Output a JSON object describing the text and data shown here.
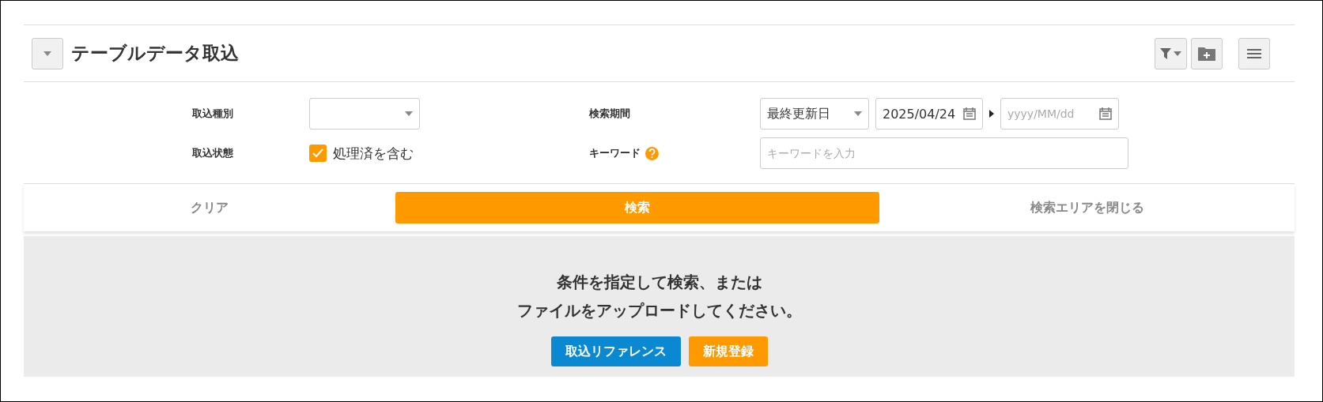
{
  "header": {
    "title": "テーブルデータ取込"
  },
  "search_form": {
    "fields": [
      {
        "kind": "select",
        "label": "取込種別"
      },
      {
        "kind": "period",
        "label": "検索期間",
        "select_value": "最終更新日",
        "from_value": "2025/04/24",
        "to_placeholder": "yyyy/MM/dd"
      },
      {
        "kind": "checkbox",
        "label": "取込状態",
        "option": "処理済を含む",
        "checked": true
      },
      {
        "kind": "keyword",
        "label": "キーワード",
        "placeholder": "キーワードを入力"
      }
    ]
  },
  "actions": {
    "clear": "クリア",
    "search": "検索",
    "close": "検索エリアを閉じる"
  },
  "empty_state": {
    "lines": [
      "条件を指定して検索、または",
      "ファイルをアップロードしてください。"
    ],
    "buttons": [
      {
        "label": "取込リファレンス",
        "color": "#0a89d2"
      },
      {
        "label": "新規登録",
        "color": "#ff9900"
      }
    ]
  }
}
